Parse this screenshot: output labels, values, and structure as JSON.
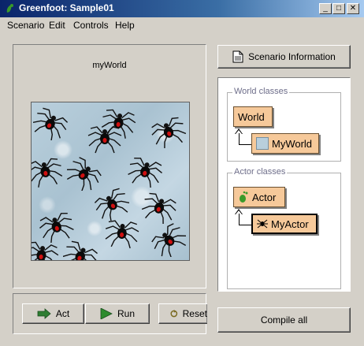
{
  "window": {
    "title": "Greenfoot: Sample01"
  },
  "menu": [
    "Scenario",
    "Edit",
    "Controls",
    "Help"
  ],
  "world": {
    "label": "myWorld",
    "spider_count": 14
  },
  "controls": {
    "act": "Act",
    "run": "Run",
    "reset": "Reset"
  },
  "right": {
    "scenario_info": "Scenario Information",
    "world_classes_title": "World classes",
    "world_class": "World",
    "world_subclass": "MyWorld",
    "actor_classes_title": "Actor classes",
    "actor_class": "Actor",
    "actor_subclass": "MyActor",
    "compile_all": "Compile all"
  },
  "colors": {
    "class_fill": "#f6c99a",
    "title_bar": "#0a246a"
  }
}
